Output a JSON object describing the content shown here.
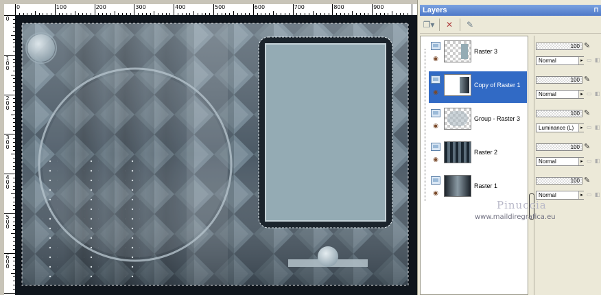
{
  "ruler": {
    "h_labels": [
      "0",
      "100",
      "200",
      "300",
      "400",
      "500",
      "600",
      "700",
      "800",
      "900"
    ],
    "v_labels": [
      "0",
      "1 0 0",
      "2 0 0",
      "3 0 0",
      "4 0 0",
      "5 0 0",
      "6 0 0"
    ]
  },
  "layers_panel": {
    "title": "Layers",
    "layers": [
      {
        "name": "Raster 3",
        "opacity": "100",
        "blend": "Normal",
        "selected": false,
        "thumb": "raster3"
      },
      {
        "name": "Copy of Raster 1",
        "opacity": "100",
        "blend": "Normal",
        "selected": true,
        "thumb": "copy"
      },
      {
        "name": "Group - Raster 3",
        "opacity": "100",
        "blend": "Luminance (L)",
        "selected": false,
        "thumb": "group"
      },
      {
        "name": "Raster 2",
        "opacity": "100",
        "blend": "Normal",
        "selected": false,
        "thumb": "raster2"
      },
      {
        "name": "Raster 1",
        "opacity": "100",
        "blend": "Normal",
        "selected": false,
        "thumb": "raster1"
      }
    ]
  },
  "watermark": {
    "name": "Pinuccia",
    "url": "www.maildiregrafica.eu"
  },
  "colors": {
    "selection": "#316ac5",
    "title_bar": "#4e78c8",
    "frame_blue_gray": "#94abb4"
  },
  "icons": {
    "pin": "pin-icon",
    "new_layer": "new-layer-icon",
    "delete_layer": "delete-layer-icon",
    "edit_selection": "edit-selection-icon",
    "visibility": "visibility-toggle-icon",
    "eye": "eye-icon",
    "brush": "paintbrush-icon",
    "lock": "lock-icon",
    "mask": "mask-icon"
  }
}
